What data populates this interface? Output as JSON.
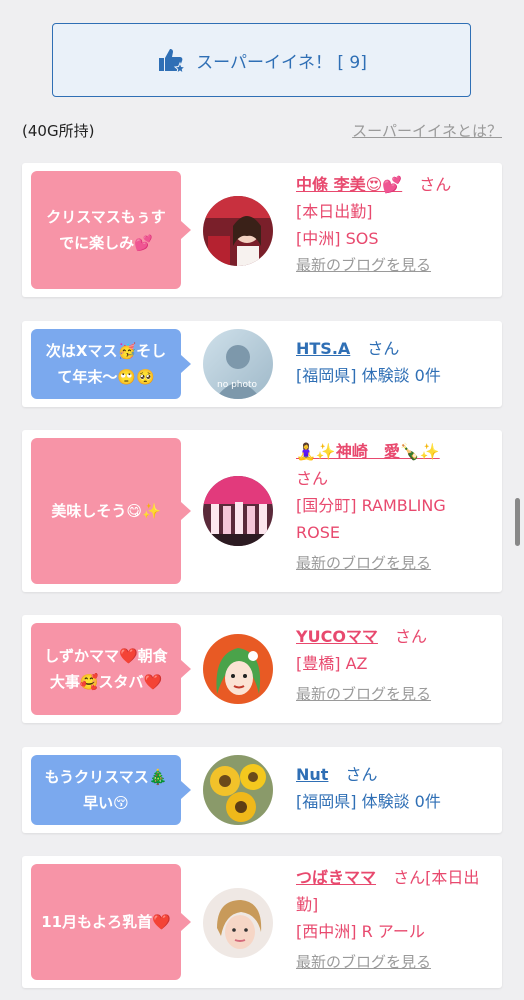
{
  "super_button": {
    "label": "スーパーイイネ！ [ 9]"
  },
  "owned_label": "(40G所持)",
  "what_link": "スーパーイイネとは？",
  "colors": {
    "pink": "#f794a7",
    "blue": "#7ba9ee",
    "name_pink": "#e8496e",
    "name_blue": "#2f6fb5"
  },
  "cards": [
    {
      "bubble": "クリスマスもぅすでに楽しみ💕",
      "bubble_color": "pink",
      "name": "中條 李美😍💕",
      "san": "さん",
      "lines": [
        "[本日出勤]",
        "[中洲] SOS"
      ],
      "blog": "最新のブログを見る"
    },
    {
      "bubble": "次はXマス🥳そして年末〜🙄🥺",
      "bubble_color": "blue",
      "name": "HTS.A",
      "san": "さん",
      "lines": [
        "[福岡県] 体験談 0件"
      ],
      "avatar_text": "no photo"
    },
    {
      "bubble": "美味しそう😋✨",
      "bubble_color": "pink",
      "name": "🧘‍♀️✨神崎　愛🍾✨",
      "san": "さん",
      "lines": [
        "[国分町] RAMBLING ROSE"
      ],
      "blog": "最新のブログを見る"
    },
    {
      "bubble": "しずかママ❤️朝食大事🥰スタバ❤️",
      "bubble_color": "pink",
      "name": "YUCOママ",
      "san": "さん",
      "lines": [
        "[豊橋] AZ"
      ],
      "blog": "最新のブログを見る"
    },
    {
      "bubble": "もうクリスマス🎄早い😚",
      "bubble_color": "blue",
      "name": "Nut",
      "san": "さん",
      "lines": [
        "[福岡県] 体験談 0件"
      ]
    },
    {
      "bubble": "11月もよろ乳首❤️",
      "bubble_color": "pink",
      "name": "つばきママ",
      "san": "さん[本日出勤]",
      "lines": [
        "[西中洲] R アール"
      ],
      "blog": "最新のブログを見る"
    }
  ]
}
